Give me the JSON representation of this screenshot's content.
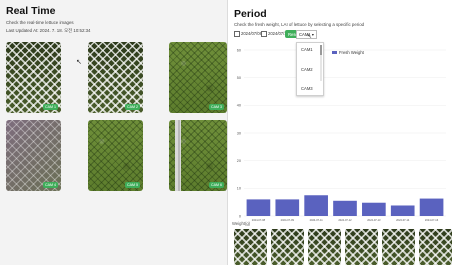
{
  "realtime": {
    "title": "Real Time",
    "subtitle": "Check the real-time lettuce images",
    "last_updated": "Last Updated At: 2024. 7. 18. 오전 10:52:34",
    "images": [
      {
        "camera": "CAM 1"
      },
      {
        "camera": "CAM 2"
      },
      {
        "camera": "CAM 3"
      },
      {
        "camera": "CAM 4"
      },
      {
        "camera": "CAM 5"
      },
      {
        "camera": "CAM 6"
      }
    ]
  },
  "period": {
    "title": "Period",
    "subtitle": "Check the fresh weight, LAI of lettuce by selecting a specific period",
    "start_date": "2024/07/08",
    "end_date": "2024/07/17",
    "reset_label": "Reset",
    "camera_select": "CAM1",
    "dropdown_options": [
      "CAM1",
      "CAM2",
      "CAM3"
    ],
    "legend": "Fresh Weight",
    "accent_color": "#3fae5a",
    "series_color": "#5a62bf"
  },
  "chart_data": {
    "type": "bar",
    "categories": [
      "2024-07-08",
      "2024-07-09",
      "2024-07-11",
      "2024-07-12",
      "2024-07-13",
      "2024-07-14",
      "2024-07-16"
    ],
    "series": [
      {
        "name": "Fresh Weight",
        "values": [
          6.0,
          6.0,
          7.5,
          5.5,
          4.8,
          3.8,
          6.3
        ]
      }
    ],
    "ylim": [
      0,
      60
    ],
    "yticks": [
      0,
      10,
      20,
      30,
      40,
      50,
      60
    ],
    "ylabel": "Weight(g)",
    "legend_position": "top-right",
    "grid": true
  }
}
